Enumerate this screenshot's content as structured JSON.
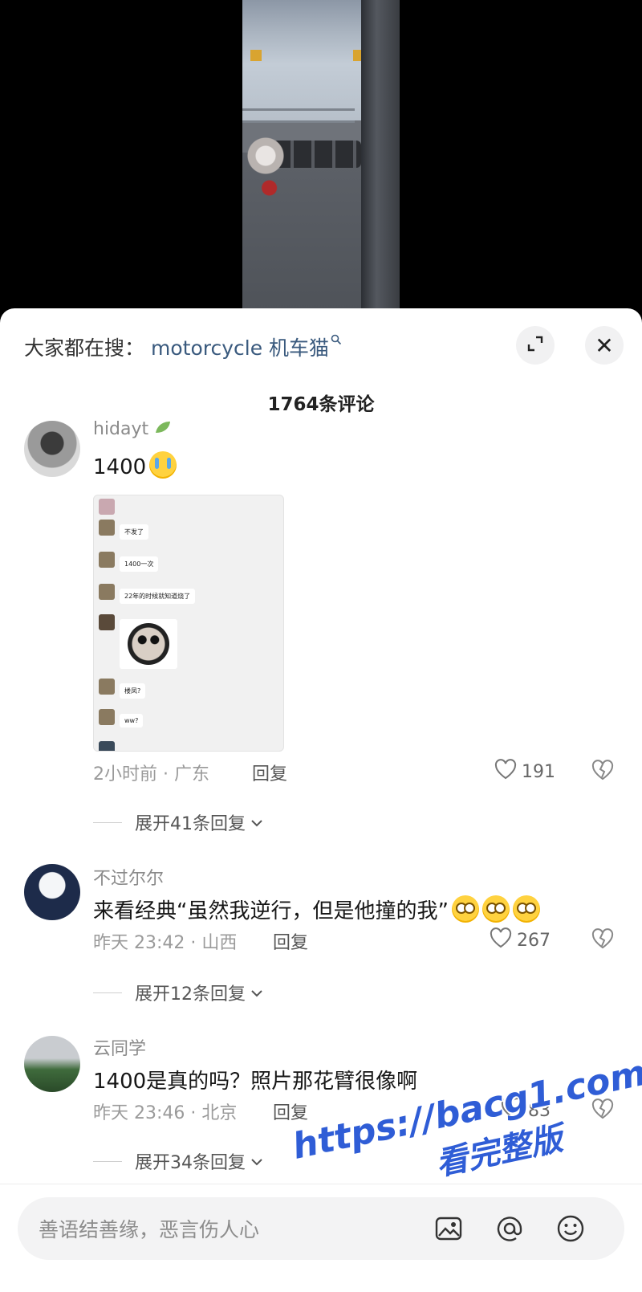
{
  "search": {
    "prefix": "大家都在搜：",
    "term": "motorcycle 机车猫",
    "query_icon": "search-icon"
  },
  "header": {
    "comment_count": "1764条评论",
    "expand_icon": "fullscreen-icon",
    "close_label": "✕"
  },
  "comments": [
    {
      "username": "hidayt",
      "badge_icon": "leaf-icon",
      "text": "1400",
      "emoji": "crying-emoji",
      "image": {
        "messages": [
          "不发了",
          "1400一次",
          "22年的时候就知道烧了",
          "楼凤?",
          "ww?"
        ],
        "sticker": "panda-meme"
      },
      "time_location": "2小时前 · 广东",
      "reply_label": "回复",
      "likes": "191",
      "expand_label": "展开41条回复"
    },
    {
      "username": "不过尔尔",
      "text": "来看经典“虽然我逆行，但是他撞的我”",
      "emoji": "wide-eyes-emoji",
      "time_location": "昨天 23:42 · 山西",
      "reply_label": "回复",
      "likes": "267",
      "expand_label": "展开12条回复"
    },
    {
      "username": "云同学",
      "text": "1400是真的吗？照片那花臂很像啊",
      "time_location": "昨天 23:46 · 北京",
      "reply_label": "回复",
      "likes": "83",
      "expand_label": "展开34条回复"
    }
  ],
  "input": {
    "placeholder": "善语结善缘，恶言伤人心",
    "icons": [
      "image-icon",
      "at-icon",
      "emoji-icon"
    ]
  },
  "watermark": {
    "line1": "https://bacg1.com",
    "line2": "看完整版"
  }
}
